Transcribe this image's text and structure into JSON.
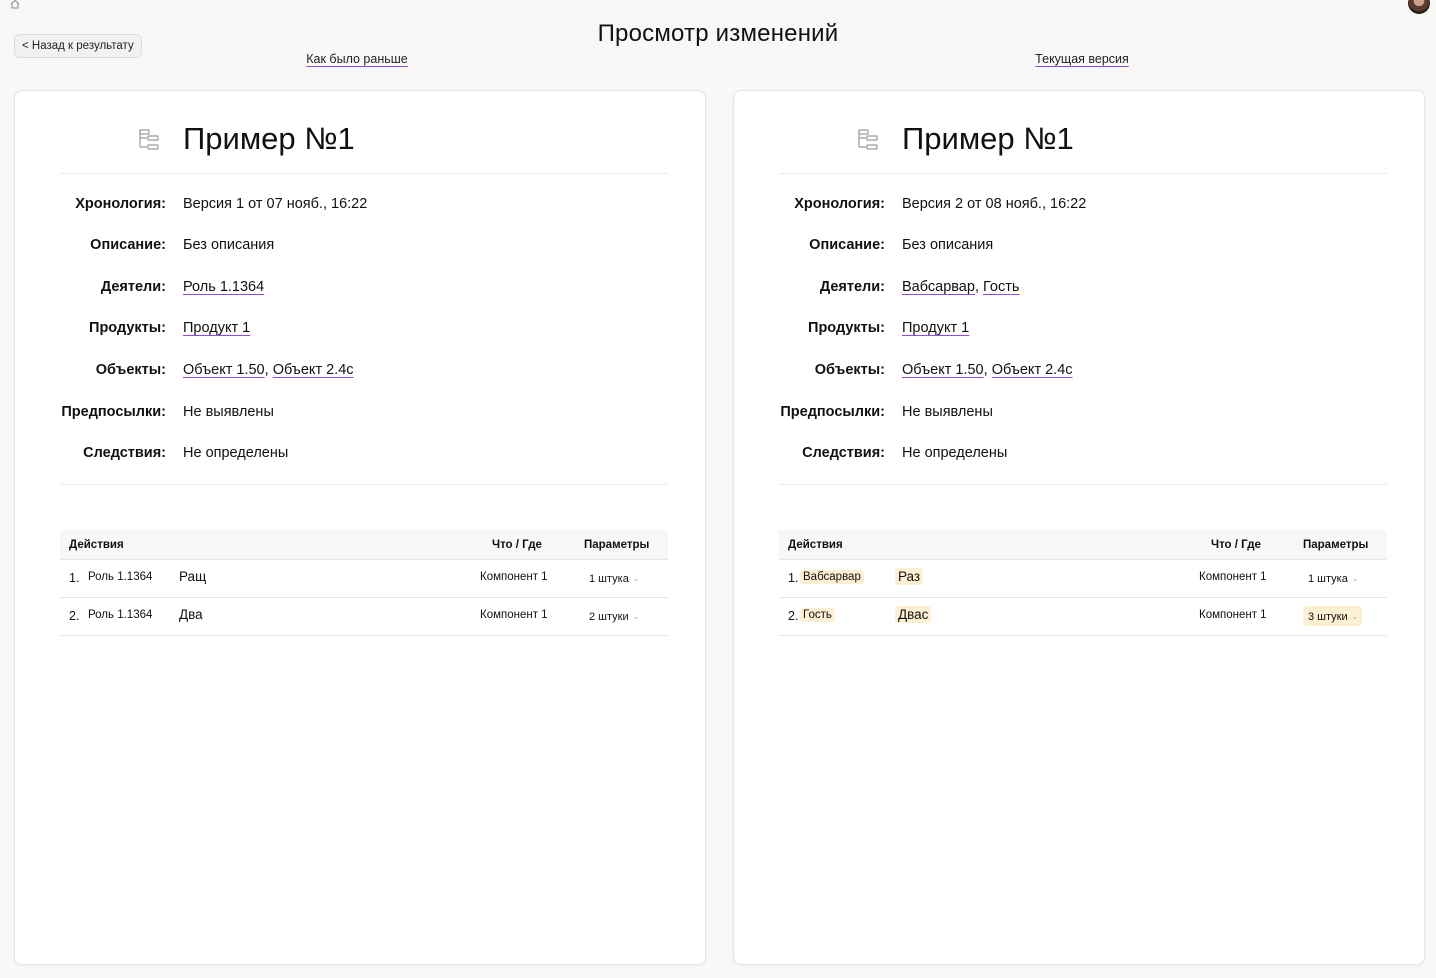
{
  "header": {
    "title": "Просмотр изменений",
    "back_label": "< Назад к результату",
    "left_label": "Как было раньше",
    "right_label": "Текущая версия"
  },
  "field_labels": {
    "chronology": "Хронология:",
    "description": "Описание:",
    "actors": "Деятели:",
    "products": "Продукты:",
    "objects": "Объекты:",
    "prerequisites": "Предпосылки:",
    "consequences": "Следствия:"
  },
  "table_headers": {
    "actions": "Действия",
    "where": "Что / Где",
    "params": "Параметры"
  },
  "accent_color": "#8f49e8",
  "highlight_color": "#fdf0d2",
  "left": {
    "title": "Пример №1",
    "chronology": "Версия 1 от 07 нояб., 16:22",
    "description": "Без описания",
    "actors": [
      "Роль 1.1364"
    ],
    "products": [
      "Продукт 1"
    ],
    "objects": [
      "Объект 1.50",
      "Объект 2.4с"
    ],
    "prerequisites": "Не выявлены",
    "consequences": "Не определены",
    "rows": [
      {
        "num": "1.",
        "actor": "Роль 1.1364",
        "action": "Ращ",
        "where": "Компонент 1",
        "param": "1 штука"
      },
      {
        "num": "2.",
        "actor": "Роль 1.1364",
        "action": "Два",
        "where": "Компонент 1",
        "param": "2 штуки"
      }
    ]
  },
  "right": {
    "title": "Пример №1",
    "chronology": "Версия 2 от 08 нояб., 16:22",
    "description": "Без описания",
    "actors": [
      "Вабсарвар",
      "Гость"
    ],
    "products": [
      "Продукт 1"
    ],
    "objects": [
      "Объект 1.50",
      "Объект 2.4с"
    ],
    "prerequisites": "Не выявлены",
    "consequences": "Не определены",
    "rows": [
      {
        "num": "1.",
        "actor": "Вабсарвар",
        "action": "Раз",
        "where": "Компонент 1",
        "param": "1 штука"
      },
      {
        "num": "2.",
        "actor": "Гость",
        "action": "Двас",
        "where": "Компонент 1",
        "param": "3 штуки"
      }
    ]
  }
}
